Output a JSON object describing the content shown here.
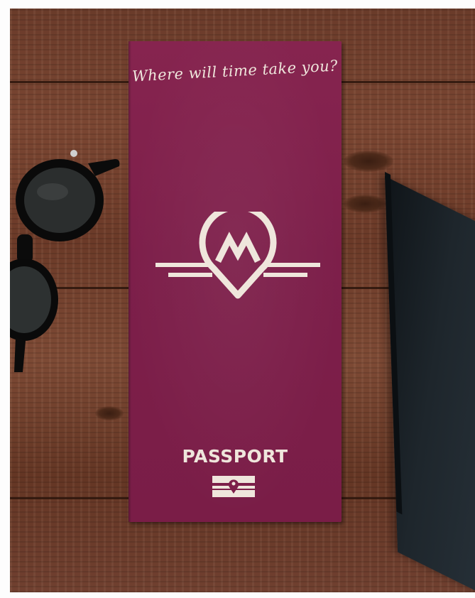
{
  "scene": {
    "tagline": "Where will time take you?",
    "cover_title": "PASSPORT",
    "cover_color": "#7d1f4a",
    "foil_color": "#efe6dc",
    "icons": [
      "mountain-pin-logo-icon",
      "epassport-chip-icon",
      "sunglasses",
      "dark-box"
    ]
  }
}
